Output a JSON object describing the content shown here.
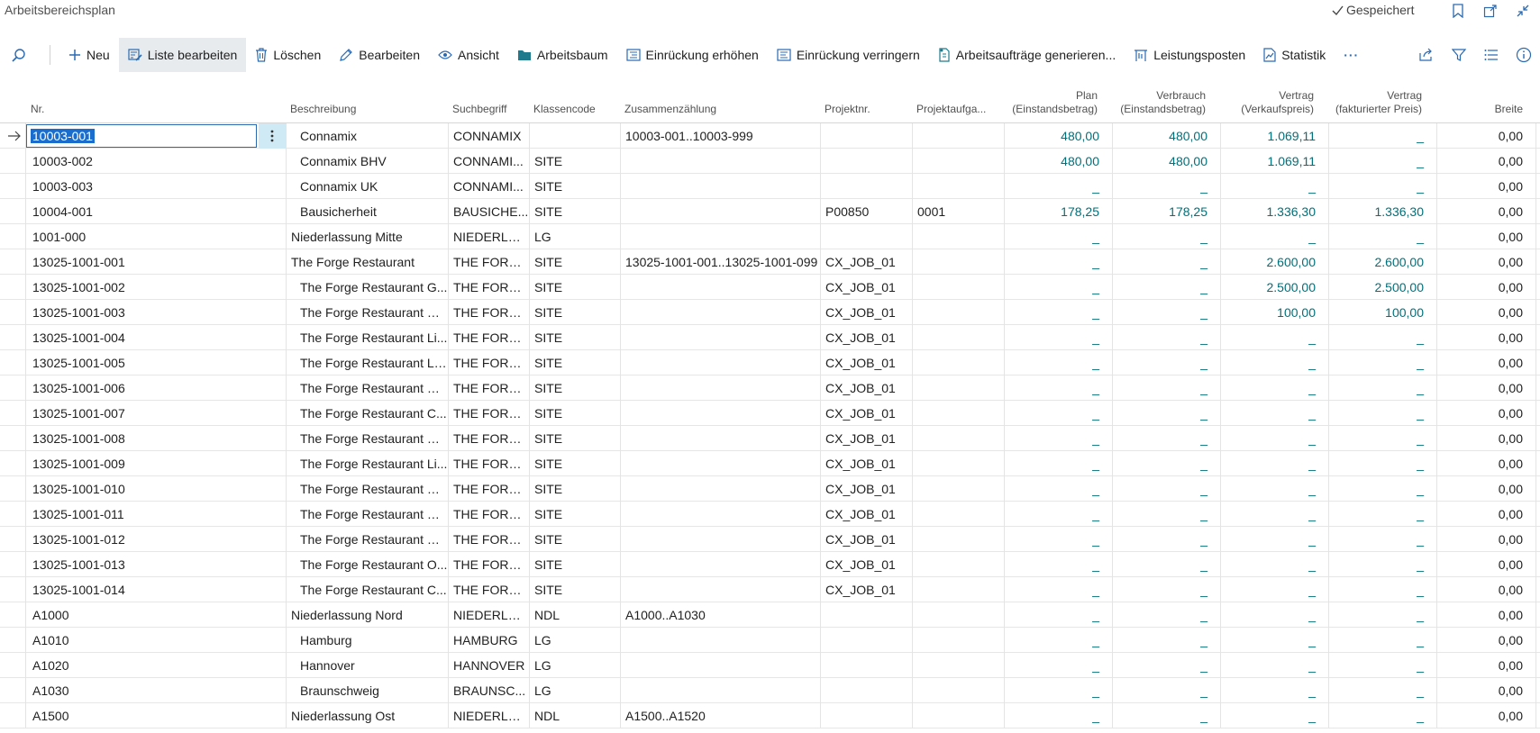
{
  "window": {
    "title": "Arbeitsbereichsplan",
    "saved": "Gespeichert"
  },
  "toolbar": {
    "actions": [
      {
        "label": "Neu",
        "icon": "plus-icon"
      },
      {
        "label": "Liste bearbeiten",
        "icon": "edit-list-icon"
      },
      {
        "label": "Löschen",
        "icon": "trash-icon"
      },
      {
        "label": "Bearbeiten",
        "icon": "pencil-icon"
      },
      {
        "label": "Ansicht",
        "icon": "eye-icon"
      },
      {
        "label": "Arbeitsbaum",
        "icon": "folder-icon"
      },
      {
        "label": "Einrückung erhöhen",
        "icon": "indent-icon"
      },
      {
        "label": "Einrückung verringern",
        "icon": "outdent-icon"
      },
      {
        "label": "Arbeitsaufträge generieren...",
        "icon": "generate-icon"
      },
      {
        "label": "Leistungsposten",
        "icon": "ledger-icon"
      },
      {
        "label": "Statistik",
        "icon": "statistics-icon"
      }
    ],
    "more": "···"
  },
  "columns": {
    "nr": "Nr.",
    "beschreibung": "Beschreibung",
    "suchbegriff": "Suchbegriff",
    "klassencode": "Klassencode",
    "zusammenzaehlung": "Zusammenzählung",
    "projektnr": "Projektnr.",
    "projektaufgabe": "Projektaufga...",
    "plan_l1": "Plan",
    "plan_l2": "(Einstandsbetrag)",
    "verbrauch_l1": "Verbrauch",
    "verbrauch_l2": "(Einstandsbetrag)",
    "vertrag_l1": "Vertrag",
    "vertrag_l2": "(Verkaufspreis)",
    "vertragf_l1": "Vertrag",
    "vertragf_l2": "(fakturierter Preis)",
    "breite": "Breite"
  },
  "rows": [
    {
      "nr": "10003-001",
      "desc": "Connamix",
      "such": "CONNAMIX",
      "klasse": "",
      "zus": "10003-001..10003-999",
      "proj": "",
      "aufg": "",
      "plan": "480,00",
      "verb": "480,00",
      "vert": "1.069,11",
      "vertf": "_",
      "breite": "0,00",
      "indent": true
    },
    {
      "nr": "10003-002",
      "desc": "Connamix BHV",
      "such": "CONNAMI...",
      "klasse": "SITE",
      "zus": "",
      "proj": "",
      "aufg": "",
      "plan": "480,00",
      "verb": "480,00",
      "vert": "1.069,11",
      "vertf": "_",
      "breite": "0,00",
      "indent": true
    },
    {
      "nr": "10003-003",
      "desc": "Connamix UK",
      "such": "CONNAMI...",
      "klasse": "SITE",
      "zus": "",
      "proj": "",
      "aufg": "",
      "plan": "_",
      "verb": "_",
      "vert": "_",
      "vertf": "_",
      "breite": "0,00",
      "indent": true
    },
    {
      "nr": "10004-001",
      "desc": "Bausicherheit",
      "such": "BAUSICHE...",
      "klasse": "SITE",
      "zus": "",
      "proj": "P00850",
      "aufg": "0001",
      "plan": "178,25",
      "verb": "178,25",
      "vert": "1.336,30",
      "vertf": "1.336,30",
      "breite": "0,00",
      "indent": true
    },
    {
      "nr": "1001-000",
      "desc": "Niederlassung Mitte",
      "such": "NIEDERLAS...",
      "klasse": "LG",
      "zus": "",
      "proj": "",
      "aufg": "",
      "plan": "_",
      "verb": "_",
      "vert": "_",
      "vertf": "_",
      "breite": "0,00",
      "indent": false
    },
    {
      "nr": "13025-1001-001",
      "desc": "The Forge Restaurant",
      "such": "THE FORGE...",
      "klasse": "SITE",
      "zus": "13025-1001-001..13025-1001-099",
      "proj": "CX_JOB_01",
      "aufg": "",
      "plan": "_",
      "verb": "_",
      "vert": "2.600,00",
      "vertf": "2.600,00",
      "breite": "0,00",
      "indent": false
    },
    {
      "nr": "13025-1001-002",
      "desc": "The Forge Restaurant G...",
      "such": "THE FORGE...",
      "klasse": "SITE",
      "zus": "",
      "proj": "CX_JOB_01",
      "aufg": "",
      "plan": "_",
      "verb": "_",
      "vert": "2.500,00",
      "vertf": "2.500,00",
      "breite": "0,00",
      "indent": true
    },
    {
      "nr": "13025-1001-003",
      "desc": "The Forge Restaurant Sc...",
      "such": "THE FORGE...",
      "klasse": "SITE",
      "zus": "",
      "proj": "CX_JOB_01",
      "aufg": "",
      "plan": "_",
      "verb": "_",
      "vert": "100,00",
      "vertf": "100,00",
      "breite": "0,00",
      "indent": true
    },
    {
      "nr": "13025-1001-004",
      "desc": "The Forge Restaurant Li...",
      "such": "THE FORGE...",
      "klasse": "SITE",
      "zus": "",
      "proj": "CX_JOB_01",
      "aufg": "",
      "plan": "_",
      "verb": "_",
      "vert": "_",
      "vertf": "_",
      "breite": "0,00",
      "indent": true
    },
    {
      "nr": "13025-1001-005",
      "desc": "The Forge Restaurant Le...",
      "such": "THE FORGE...",
      "klasse": "SITE",
      "zus": "",
      "proj": "CX_JOB_01",
      "aufg": "",
      "plan": "_",
      "verb": "_",
      "vert": "_",
      "vertf": "_",
      "breite": "0,00",
      "indent": true
    },
    {
      "nr": "13025-1001-006",
      "desc": "The Forge Restaurant M...",
      "such": "THE FORGE...",
      "klasse": "SITE",
      "zus": "",
      "proj": "CX_JOB_01",
      "aufg": "",
      "plan": "_",
      "verb": "_",
      "vert": "_",
      "vertf": "_",
      "breite": "0,00",
      "indent": true
    },
    {
      "nr": "13025-1001-007",
      "desc": "The Forge Restaurant C...",
      "such": "THE FORGE...",
      "klasse": "SITE",
      "zus": "",
      "proj": "CX_JOB_01",
      "aufg": "",
      "plan": "_",
      "verb": "_",
      "vert": "_",
      "vertf": "_",
      "breite": "0,00",
      "indent": true
    },
    {
      "nr": "13025-1001-008",
      "desc": "The Forge Restaurant M...",
      "such": "THE FORGE...",
      "klasse": "SITE",
      "zus": "",
      "proj": "CX_JOB_01",
      "aufg": "",
      "plan": "_",
      "verb": "_",
      "vert": "_",
      "vertf": "_",
      "breite": "0,00",
      "indent": true
    },
    {
      "nr": "13025-1001-009",
      "desc": "The Forge Restaurant Li...",
      "such": "THE FORGE...",
      "klasse": "SITE",
      "zus": "",
      "proj": "CX_JOB_01",
      "aufg": "",
      "plan": "_",
      "verb": "_",
      "vert": "_",
      "vertf": "_",
      "breite": "0,00",
      "indent": true
    },
    {
      "nr": "13025-1001-010",
      "desc": "The Forge Restaurant Gl...",
      "such": "THE FORGE...",
      "klasse": "SITE",
      "zus": "",
      "proj": "CX_JOB_01",
      "aufg": "",
      "plan": "_",
      "verb": "_",
      "vert": "_",
      "vertf": "_",
      "breite": "0,00",
      "indent": true
    },
    {
      "nr": "13025-1001-011",
      "desc": "The Forge Restaurant Ed...",
      "such": "THE FORGE...",
      "klasse": "SITE",
      "zus": "",
      "proj": "CX_JOB_01",
      "aufg": "",
      "plan": "_",
      "verb": "_",
      "vert": "_",
      "vertf": "_",
      "breite": "0,00",
      "indent": true
    },
    {
      "nr": "13025-1001-012",
      "desc": "The Forge Restaurant Bi...",
      "such": "THE FORGE...",
      "klasse": "SITE",
      "zus": "",
      "proj": "CX_JOB_01",
      "aufg": "",
      "plan": "_",
      "verb": "_",
      "vert": "_",
      "vertf": "_",
      "breite": "0,00",
      "indent": true
    },
    {
      "nr": "13025-1001-013",
      "desc": "The Forge Restaurant O...",
      "such": "THE FORGE...",
      "klasse": "SITE",
      "zus": "",
      "proj": "CX_JOB_01",
      "aufg": "",
      "plan": "_",
      "verb": "_",
      "vert": "_",
      "vertf": "_",
      "breite": "0,00",
      "indent": true
    },
    {
      "nr": "13025-1001-014",
      "desc": "The Forge Restaurant C...",
      "such": "THE FORGE...",
      "klasse": "SITE",
      "zus": "",
      "proj": "CX_JOB_01",
      "aufg": "",
      "plan": "_",
      "verb": "_",
      "vert": "_",
      "vertf": "_",
      "breite": "0,00",
      "indent": true
    },
    {
      "nr": "A1000",
      "desc": "Niederlassung Nord",
      "such": "NIEDERLAS...",
      "klasse": "NDL",
      "zus": "A1000..A1030",
      "proj": "",
      "aufg": "",
      "plan": "_",
      "verb": "_",
      "vert": "_",
      "vertf": "_",
      "breite": "0,00",
      "indent": false
    },
    {
      "nr": "A1010",
      "desc": "Hamburg",
      "such": "HAMBURG",
      "klasse": "LG",
      "zus": "",
      "proj": "",
      "aufg": "",
      "plan": "_",
      "verb": "_",
      "vert": "_",
      "vertf": "_",
      "breite": "0,00",
      "indent": true
    },
    {
      "nr": "A1020",
      "desc": "Hannover",
      "such": "HANNOVER",
      "klasse": "LG",
      "zus": "",
      "proj": "",
      "aufg": "",
      "plan": "_",
      "verb": "_",
      "vert": "_",
      "vertf": "_",
      "breite": "0,00",
      "indent": true
    },
    {
      "nr": "A1030",
      "desc": "Braunschweig",
      "such": "BRAUNSC...",
      "klasse": "LG",
      "zus": "",
      "proj": "",
      "aufg": "",
      "plan": "_",
      "verb": "_",
      "vert": "_",
      "vertf": "_",
      "breite": "0,00",
      "indent": true
    },
    {
      "nr": "A1500",
      "desc": "Niederlassung Ost",
      "such": "NIEDERLAS...",
      "klasse": "NDL",
      "zus": "A1500..A1520",
      "proj": "",
      "aufg": "",
      "plan": "_",
      "verb": "_",
      "vert": "_",
      "vertf": "_",
      "breite": "0,00",
      "indent": false
    }
  ]
}
